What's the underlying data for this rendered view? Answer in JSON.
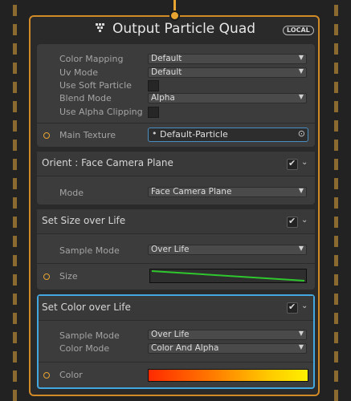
{
  "node": {
    "title": "Output Particle Quad",
    "badge": "LOCAL",
    "title_icon": "vfx-output-icon",
    "color_accent": "#d08a28",
    "selected_accent": "#44a8e0"
  },
  "properties": {
    "color_mapping": {
      "label": "Color Mapping",
      "value": "Default"
    },
    "uv_mode": {
      "label": "Uv Mode",
      "value": "Default"
    },
    "soft_particle": {
      "label": "Use Soft Particle",
      "checked": false
    },
    "blend_mode": {
      "label": "Blend Mode",
      "value": "Alpha"
    },
    "alpha_clipping": {
      "label": "Use Alpha Clipping",
      "checked": false
    },
    "main_texture": {
      "label": "Main Texture",
      "value": "Default-Particle"
    }
  },
  "blocks": [
    {
      "title": "Orient : Face Camera Plane",
      "enabled": true,
      "fields": [
        {
          "label": "Mode",
          "value": "Face Camera Plane"
        }
      ]
    },
    {
      "title": "Set Size over Life",
      "enabled": true,
      "fields": [
        {
          "label": "Sample Mode",
          "value": "Over Life"
        }
      ],
      "port_label": "Size"
    },
    {
      "title": "Set Color over Life",
      "enabled": true,
      "selected": true,
      "fields": [
        {
          "label": "Sample Mode",
          "value": "Over Life"
        },
        {
          "label": "Color Mode",
          "value": "Color And Alpha"
        }
      ],
      "port_label": "Color"
    }
  ],
  "icons": {
    "dropdown": "▼",
    "collapse": "⌄",
    "object_picker": "⊙",
    "object_dot": "•"
  }
}
